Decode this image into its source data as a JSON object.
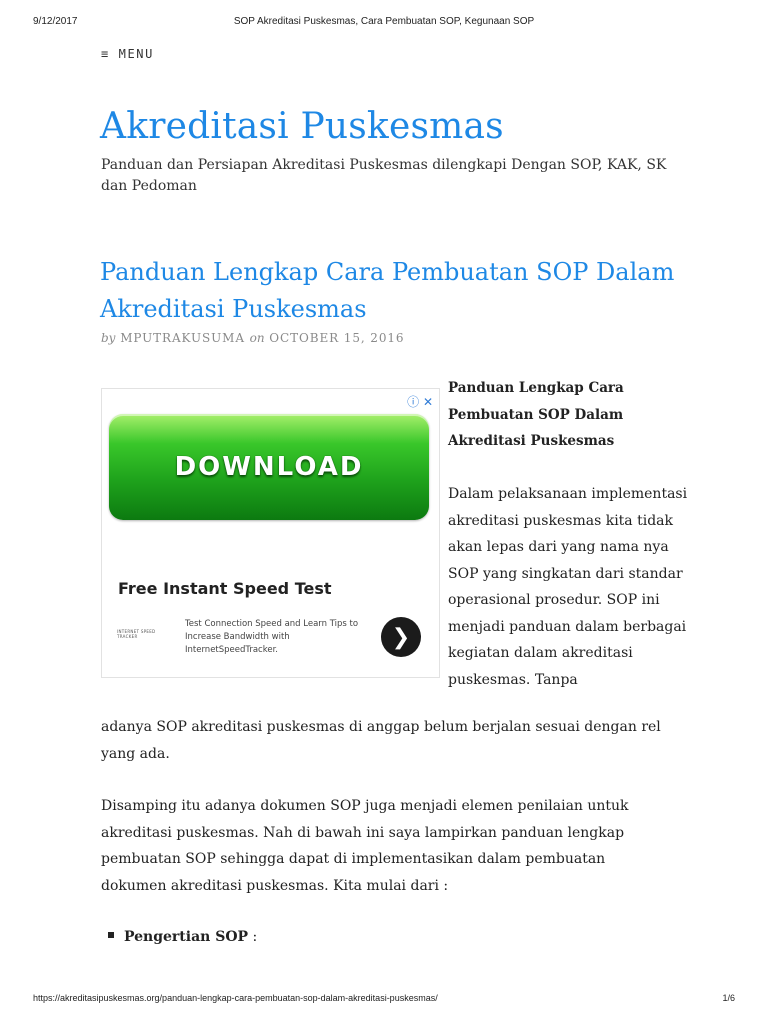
{
  "print_header": {
    "date": "9/12/2017",
    "title": "SOP Akreditasi Puskesmas, Cara Pembuatan SOP, Kegunaan SOP"
  },
  "menu_label": "≡ MENU",
  "site": {
    "title": "Akreditasi Puskesmas",
    "description": "Panduan dan Persiapan Akreditasi Puskesmas dilengkapi Dengan SOP, KAK, SK dan Pedoman"
  },
  "post": {
    "title": "Panduan Lengkap Cara Pembuatan SOP Dalam Akreditasi Puskesmas",
    "by": "by",
    "author": "MPUTRAKUSUMA",
    "on": "on",
    "date": "OCTOBER 15, 2016",
    "intro_heading": "Panduan Lengkap Cara Pembuatan SOP Dalam Akreditasi Puskesmas",
    "p1_side": "Dalam pelaksanaan implementasi akreditasi puskesmas kita tidak akan lepas dari yang nama nya SOP yang singkatan dari standar operasional prosedur. SOP ini menjadi panduan dalam berbagai kegiatan dalam akreditasi puskesmas. Tanpa",
    "p1_wrap": "adanya SOP akreditasi puskesmas di anggap belum berjalan sesuai dengan rel yang ada.",
    "p2": "Disamping itu adanya dokumen SOP juga menjadi elemen penilaian untuk akreditasi puskesmas. Nah di bawah ini saya lampirkan panduan lengkap pembuatan SOP sehingga dapat di implementasikan dalam pembuatan dokumen akreditasi puskesmas. Kita mulai dari :",
    "bullet_label": "Pengertian SOP",
    "bullet_suffix": " :"
  },
  "ad": {
    "adchoices_icons": "ⓘ ✕",
    "button_label": "DOWNLOAD",
    "headline": "Free Instant Speed Test",
    "logo_text": "INTERNET SPEED TRACKER",
    "subtext": "Test Connection Speed and Learn Tips to Increase Bandwidth with InternetSpeedTracker.",
    "arrow": "❯"
  },
  "footer": {
    "url": "https://akreditasipuskesmas.org/panduan-lengkap-cara-pembuatan-sop-dalam-akreditasi-puskesmas/",
    "page": "1/6"
  }
}
